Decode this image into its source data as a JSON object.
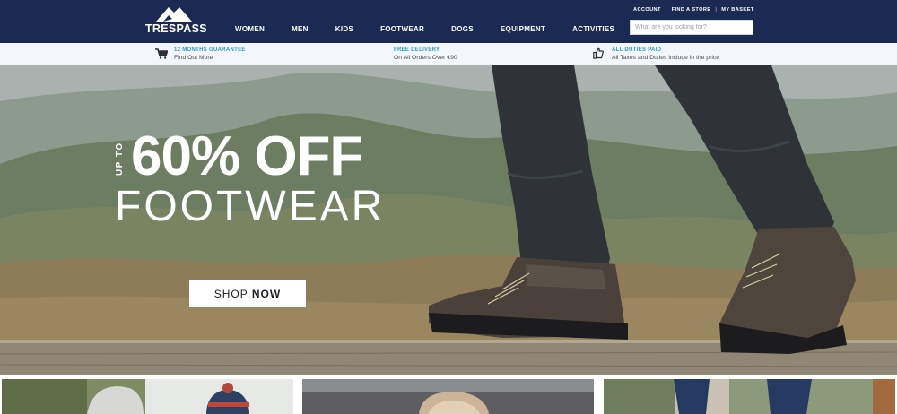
{
  "header": {
    "logo_text": "TRESPASS",
    "nav": [
      "WOMEN",
      "MEN",
      "KIDS",
      "FOOTWEAR",
      "DOGS",
      "EQUIPMENT",
      "ACTIVITIES"
    ],
    "utility_links": [
      "ACCOUNT",
      "FIND A STORE",
      "MY BASKET"
    ],
    "search_placeholder": "What are you looking for?"
  },
  "usp": [
    {
      "icon": "cart-icon",
      "title": "12 MONTHS GUARANTEE",
      "subtitle": "Find Out More"
    },
    {
      "icon": "",
      "title": "FREE DELIVERY",
      "subtitle": "On All Orders Over €90"
    },
    {
      "icon": "thumbs-up-icon",
      "title": "ALL DUTIES PAID",
      "subtitle": "All Taxes and Duties include in the price"
    }
  ],
  "hero": {
    "up_to": "UP TO",
    "headline": "60% OFF",
    "subheadline": "FOOTWEAR",
    "cta_regular": "SHOP ",
    "cta_bold": "NOW"
  },
  "colors": {
    "header_bg": "#1b2a52",
    "usp_title": "#2e9ac3",
    "usp_bg": "#f3f6fa"
  }
}
